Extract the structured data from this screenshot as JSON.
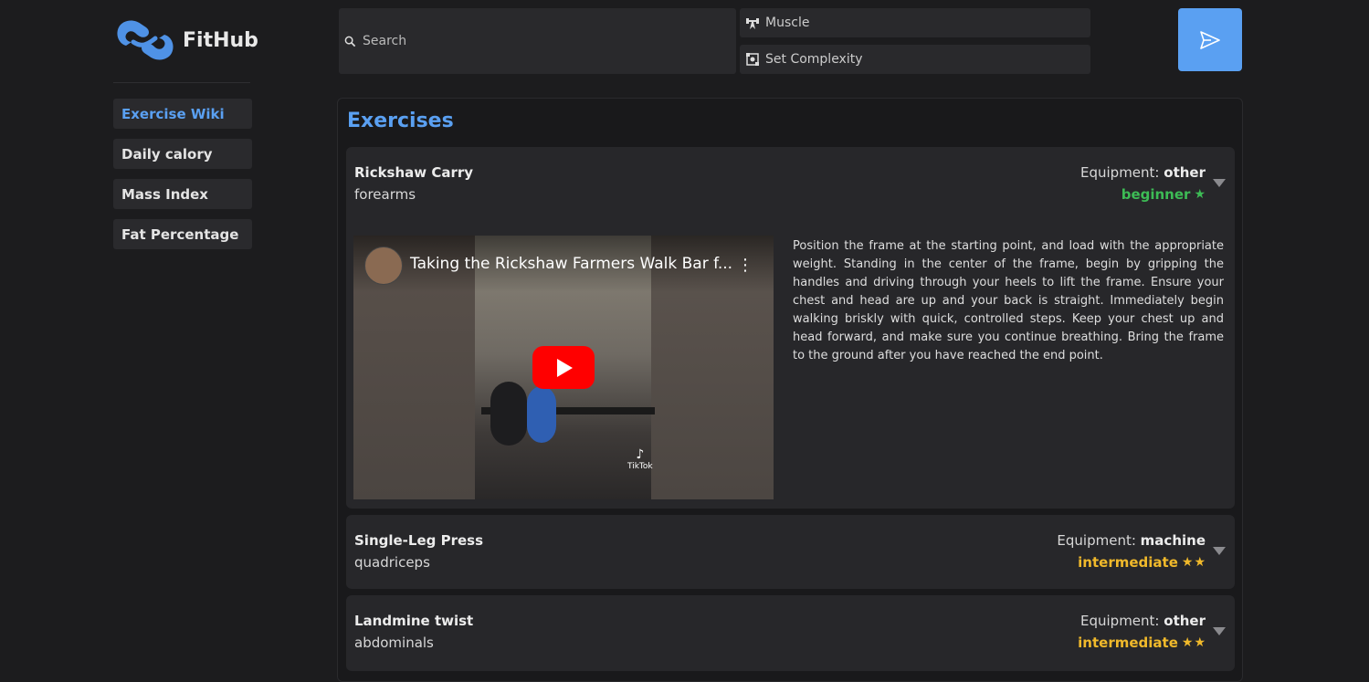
{
  "app": {
    "name": "FitHub"
  },
  "nav": [
    {
      "label": "Exercise Wiki",
      "active": true
    },
    {
      "label": "Daily calory",
      "active": false
    },
    {
      "label": "Mass Index",
      "active": false
    },
    {
      "label": "Fat Percentage",
      "active": false
    }
  ],
  "search": {
    "placeholder": "Search",
    "value": ""
  },
  "filters": {
    "muscle_label": "Muscle",
    "complexity_label": "Set Complexity"
  },
  "send_icon": "paper-plane-icon",
  "section_title": "Exercises",
  "equipment_label": "Equipment:",
  "exercises": [
    {
      "name": "Rickshaw Carry",
      "muscle": "forearms",
      "equipment": "other",
      "level": "beginner",
      "stars": 1,
      "expanded": true,
      "video_title": "Taking the Rickshaw Farmers Walk Bar f...",
      "video_brand": "TikTok",
      "description": "Position the frame at the starting point, and load with the appropriate weight. Standing in the center of the frame, begin by gripping the handles and driving through your heels to lift the frame. Ensure your chest and head are up and your back is straight. Immediately begin walking briskly with quick, controlled steps. Keep your chest up and head forward, and make sure you continue breathing. Bring the frame to the ground after you have reached the end point."
    },
    {
      "name": "Single-Leg Press",
      "muscle": "quadriceps",
      "equipment": "machine",
      "level": "intermediate",
      "stars": 2,
      "expanded": false
    },
    {
      "name": "Landmine twist",
      "muscle": "abdominals",
      "equipment": "other",
      "level": "intermediate",
      "stars": 2,
      "expanded": false
    }
  ],
  "colors": {
    "accent": "#5aa0f2",
    "beginner": "#3dbb55",
    "intermediate": "#f0b92b",
    "background": "#1c1c1e",
    "card": "#27272a"
  }
}
